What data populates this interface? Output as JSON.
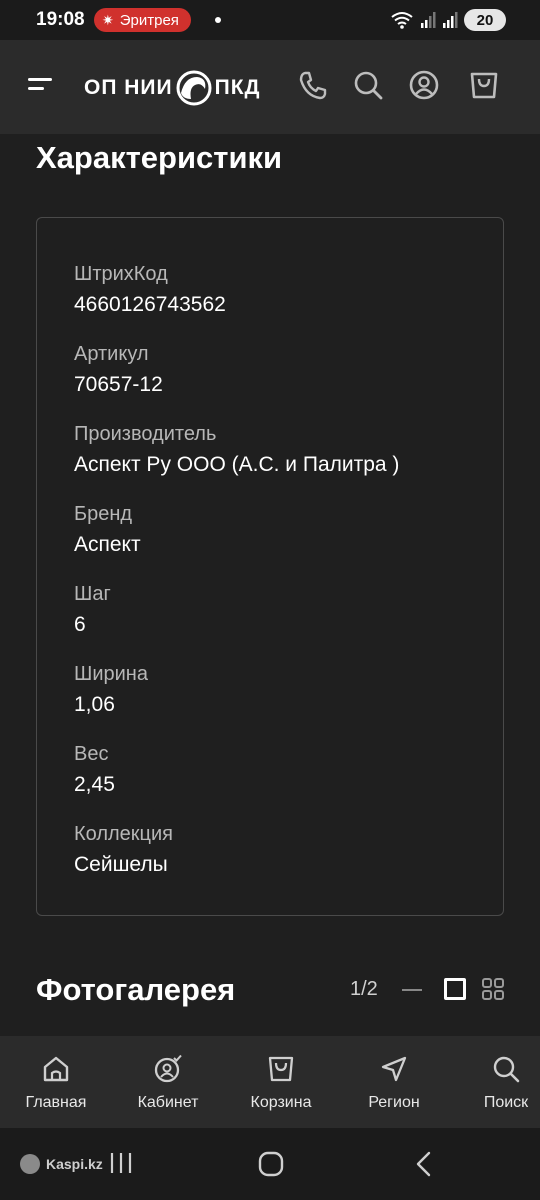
{
  "status_bar": {
    "time": "19:08",
    "notification": "Эритрея",
    "battery": "20"
  },
  "header": {
    "logo_left": "ОП НИИ",
    "logo_right": "ПКД"
  },
  "characteristics": {
    "title": "Характеристики",
    "items": [
      {
        "label": "ШтрихКод",
        "value": "4660126743562"
      },
      {
        "label": "Артикул",
        "value": "70657-12"
      },
      {
        "label": "Производитель",
        "value": "Аспект Ру ООО (А.С. и Палитра )"
      },
      {
        "label": "Бренд",
        "value": "Аспект"
      },
      {
        "label": "Шаг",
        "value": "6"
      },
      {
        "label": "Ширина",
        "value": "1,06"
      },
      {
        "label": "Вес",
        "value": "2,45"
      },
      {
        "label": "Коллекция",
        "value": "Сейшелы"
      }
    ]
  },
  "gallery": {
    "title": "Фотогалерея",
    "counter": "1/2"
  },
  "bottom_nav": {
    "items": [
      {
        "label": "Главная",
        "icon": "home-icon"
      },
      {
        "label": "Кабинет",
        "icon": "user-check-icon"
      },
      {
        "label": "Корзина",
        "icon": "bag-icon"
      },
      {
        "label": "Регион",
        "icon": "location-arrow-icon"
      },
      {
        "label": "Поиск",
        "icon": "search-icon"
      }
    ]
  },
  "system_bar": {
    "watermark": "Kaspi.kz"
  },
  "colors": {
    "background": "#1f1f1f",
    "header": "#2b2b2b",
    "notification_pill": "#d0312d"
  }
}
